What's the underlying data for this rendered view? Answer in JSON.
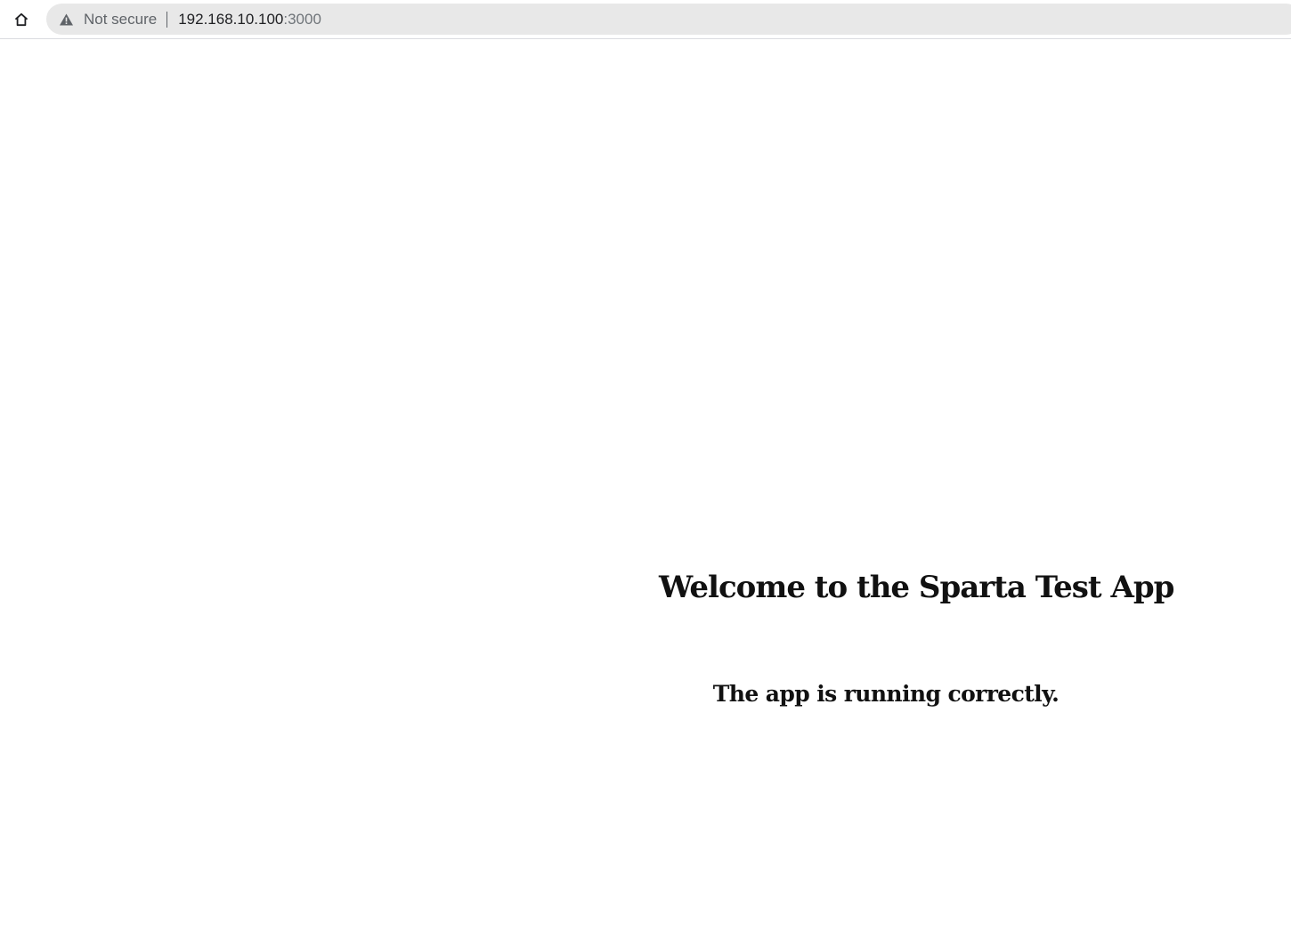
{
  "browser": {
    "home_icon": "home-icon",
    "security_icon": "warning-triangle-icon",
    "security_label": "Not secure",
    "url_host": "192.168.10.100",
    "url_port": ":3000",
    "omnibox_color": "#e8e8e8"
  },
  "page": {
    "heading": "Welcome to the Sparta Test App",
    "message": "The app is running correctly."
  }
}
